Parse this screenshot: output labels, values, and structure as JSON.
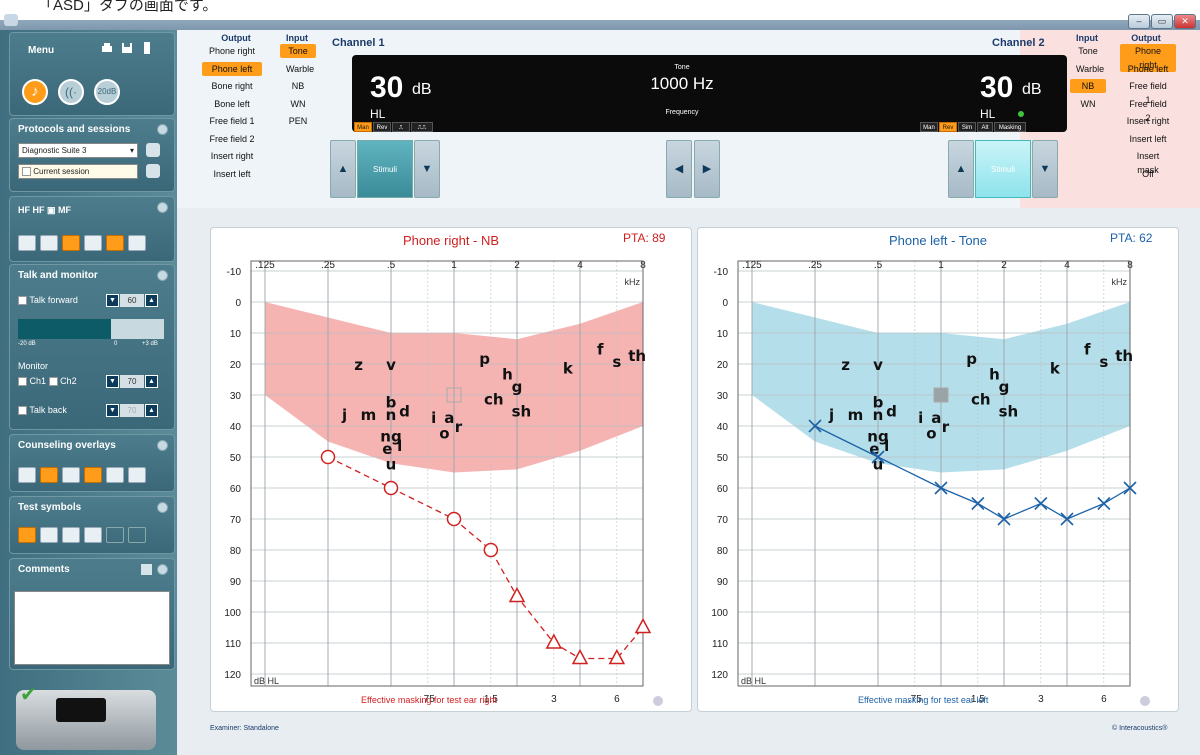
{
  "caption": "「ASD」タブの画面です。",
  "window": {
    "min": "–",
    "max": "▭",
    "close": "✕"
  },
  "sidebar": {
    "menu": "Menu",
    "protocols": {
      "title": "Protocols and sessions",
      "protocol": "Diagnostic Suite 3",
      "session": "Current session"
    },
    "talk": {
      "title": "Talk and monitor",
      "talk_forward": "Talk forward",
      "talk_forward_value": "60",
      "scale_min": "-20 dB",
      "scale_mid": "0",
      "scale_max": "+3 dB",
      "monitor": "Monitor",
      "ch1": "Ch1",
      "ch2": "Ch2",
      "monitor_value": "70",
      "talk_back": "Talk back",
      "talk_back_value": "70"
    },
    "counseling": {
      "title": "Counseling overlays"
    },
    "test_symbols": {
      "title": "Test symbols"
    },
    "comments": {
      "title": "Comments"
    },
    "icons": [
      "music-note-icon",
      "speech-icon",
      "step-20db-icon",
      "print-icon",
      "save-icon",
      "exit-icon"
    ]
  },
  "channel1": {
    "label": "Channel 1",
    "output_header": "Output",
    "input_header": "Input",
    "outputs": [
      "Phone right",
      "Phone left",
      "Bone right",
      "Bone left",
      "Free field 1",
      "Free field 2",
      "Insert right",
      "Insert left"
    ],
    "inputs": [
      "Tone",
      "Warble",
      "NB",
      "WN",
      "PEN"
    ],
    "selected_output": 1,
    "selected_input": 0
  },
  "channel2": {
    "label": "Channel 2",
    "output_header": "Output",
    "input_header": "Input",
    "outputs": [
      "Phone right",
      "Phone left",
      "Free field 1",
      "Free field 2",
      "Insert right",
      "Insert left",
      "Insert mask",
      "Off"
    ],
    "inputs": [
      "Tone",
      "Warble",
      "NB",
      "WN"
    ],
    "selected_output": 0,
    "selected_input": 2
  },
  "display": {
    "ch1_level": "30",
    "ch1_unit": "dB",
    "ch1_hl": "HL",
    "tone_label": "Tone",
    "frequency": "1000 Hz",
    "frequency_label": "Frequency",
    "ch2_level": "30",
    "ch2_unit": "dB",
    "ch2_hl": "HL",
    "ch1_modes": [
      "Man",
      "Rev",
      "⎍",
      "⎍⎍"
    ],
    "ch2_modes": [
      "Man",
      "Rev",
      "Sim",
      "Alt",
      "Masking"
    ]
  },
  "stimuli_label": "Stimuli",
  "audiograms": [
    {
      "title": "Phone right - NB",
      "pta_label": "PTA:",
      "pta": "89",
      "color": "#d02020",
      "band_color": "#f3a7a4",
      "footer": "Effective masking for test ear right"
    },
    {
      "title": "Phone left - Tone",
      "pta_label": "PTA:",
      "pta": "62",
      "color": "#1c62a8",
      "band_color": "#a8d8e8",
      "footer": "Effective masking for test ear left"
    }
  ],
  "chart_data": [
    {
      "type": "scatter",
      "title": "Phone right - NB",
      "x_ticks_top": [
        ".125",
        ".25",
        ".5",
        "1",
        "2",
        "4",
        "8"
      ],
      "x_ticks_bottom": [
        ".75",
        "1.5",
        "3",
        "6"
      ],
      "x_unit": "kHz",
      "y_ticks": [
        "-10",
        "0",
        "10",
        "20",
        "30",
        "40",
        "50",
        "60",
        "70",
        "80",
        "90",
        "100",
        "110",
        "120"
      ],
      "ylabel": "dB HL",
      "ylim": [
        -10,
        120
      ],
      "series": [
        {
          "symbol": "circle",
          "points": [
            [
              0.25,
              50
            ],
            [
              0.5,
              60
            ],
            [
              1,
              70
            ],
            [
              1.5,
              80
            ]
          ]
        },
        {
          "symbol": "triangle",
          "points": [
            [
              2,
              95
            ],
            [
              3,
              110
            ],
            [
              4,
              115
            ],
            [
              6,
              115
            ],
            [
              8,
              105
            ]
          ]
        }
      ],
      "speech_letters": [
        {
          "t": "z",
          "x": 0.35,
          "y": 22
        },
        {
          "t": "v",
          "x": 0.5,
          "y": 22
        },
        {
          "t": "p",
          "x": 1.4,
          "y": 20
        },
        {
          "t": "h",
          "x": 1.8,
          "y": 25
        },
        {
          "t": "g",
          "x": 2,
          "y": 29
        },
        {
          "t": "k",
          "x": 3.5,
          "y": 23
        },
        {
          "t": "f",
          "x": 5,
          "y": 17
        },
        {
          "t": "s",
          "x": 6,
          "y": 21
        },
        {
          "t": "th",
          "x": 7.5,
          "y": 19
        },
        {
          "t": "j",
          "x": 0.3,
          "y": 38
        },
        {
          "t": "m",
          "x": 0.39,
          "y": 38
        },
        {
          "t": "b",
          "x": 0.5,
          "y": 34
        },
        {
          "t": "n",
          "x": 0.5,
          "y": 38
        },
        {
          "t": "d",
          "x": 0.58,
          "y": 37
        },
        {
          "t": "i",
          "x": 0.8,
          "y": 39
        },
        {
          "t": "a",
          "x": 0.95,
          "y": 39
        },
        {
          "t": "r",
          "x": 1.05,
          "y": 42
        },
        {
          "t": "o",
          "x": 0.9,
          "y": 44
        },
        {
          "t": "ch",
          "x": 1.55,
          "y": 33
        },
        {
          "t": "sh",
          "x": 2.1,
          "y": 37
        },
        {
          "t": "ng",
          "x": 0.5,
          "y": 45
        },
        {
          "t": "e",
          "x": 0.48,
          "y": 49
        },
        {
          "t": "l",
          "x": 0.55,
          "y": 48
        },
        {
          "t": "u",
          "x": 0.5,
          "y": 54
        }
      ],
      "marker": {
        "x": 1,
        "y": 30
      }
    },
    {
      "type": "scatter",
      "title": "Phone left - Tone",
      "x_ticks_top": [
        ".125",
        ".25",
        ".5",
        "1",
        "2",
        "4",
        "8"
      ],
      "x_ticks_bottom": [
        ".75",
        "1.5",
        "3",
        "6"
      ],
      "x_unit": "kHz",
      "y_ticks": [
        "-10",
        "0",
        "10",
        "20",
        "30",
        "40",
        "50",
        "60",
        "70",
        "80",
        "90",
        "100",
        "110",
        "120"
      ],
      "ylabel": "dB HL",
      "ylim": [
        -10,
        120
      ],
      "series": [
        {
          "symbol": "cross",
          "points": [
            [
              0.25,
              40
            ],
            [
              0.5,
              50
            ],
            [
              1,
              60
            ],
            [
              1.5,
              65
            ],
            [
              2,
              70
            ],
            [
              3,
              65
            ],
            [
              4,
              70
            ],
            [
              6,
              65
            ],
            [
              8,
              60
            ]
          ]
        }
      ],
      "speech_letters": [
        {
          "t": "z",
          "x": 0.35,
          "y": 22
        },
        {
          "t": "v",
          "x": 0.5,
          "y": 22
        },
        {
          "t": "p",
          "x": 1.4,
          "y": 20
        },
        {
          "t": "h",
          "x": 1.8,
          "y": 25
        },
        {
          "t": "g",
          "x": 2,
          "y": 29
        },
        {
          "t": "k",
          "x": 3.5,
          "y": 23
        },
        {
          "t": "f",
          "x": 5,
          "y": 17
        },
        {
          "t": "s",
          "x": 6,
          "y": 21
        },
        {
          "t": "th",
          "x": 7.5,
          "y": 19
        },
        {
          "t": "j",
          "x": 0.3,
          "y": 38
        },
        {
          "t": "m",
          "x": 0.39,
          "y": 38
        },
        {
          "t": "b",
          "x": 0.5,
          "y": 34
        },
        {
          "t": "n",
          "x": 0.5,
          "y": 38
        },
        {
          "t": "d",
          "x": 0.58,
          "y": 37
        },
        {
          "t": "i",
          "x": 0.8,
          "y": 39
        },
        {
          "t": "a",
          "x": 0.95,
          "y": 39
        },
        {
          "t": "r",
          "x": 1.05,
          "y": 42
        },
        {
          "t": "o",
          "x": 0.9,
          "y": 44
        },
        {
          "t": "ch",
          "x": 1.55,
          "y": 33
        },
        {
          "t": "sh",
          "x": 2.1,
          "y": 37
        },
        {
          "t": "ng",
          "x": 0.5,
          "y": 45
        },
        {
          "t": "e",
          "x": 0.48,
          "y": 49
        },
        {
          "t": "l",
          "x": 0.55,
          "y": 48
        },
        {
          "t": "u",
          "x": 0.5,
          "y": 54
        }
      ],
      "marker": {
        "x": 1,
        "y": 30
      }
    }
  ],
  "footer": {
    "examiner": "Examiner: Standalone",
    "brand": "© Interacoustics®"
  }
}
